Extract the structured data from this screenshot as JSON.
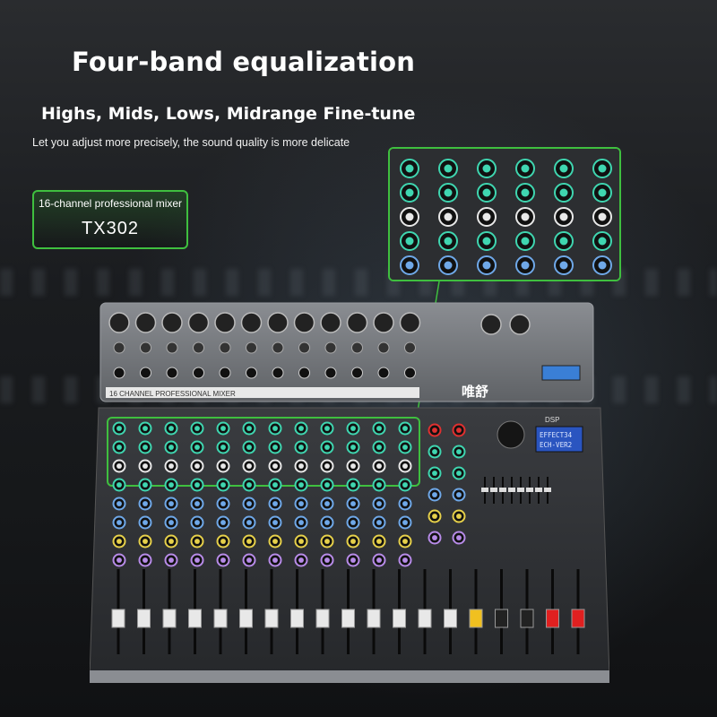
{
  "headline": "Four-band equalization",
  "subhead": "Highs, Mids, Lows, Midrange Fine-tune",
  "tagline": "Let you adjust more precisely, the sound quality is more delicate",
  "model": {
    "label": "16-channel professional mixer",
    "name": "TX302"
  },
  "mixer": {
    "panel_text": "16 CHANNEL PROFESSIONAL MIXER",
    "brand": "唯舒",
    "dsp_badge": "DSP",
    "display_line1": "EFFECT34",
    "display_line2": "ECH-VER2"
  },
  "colors": {
    "highlight": "#3fbf3f",
    "eq_knob": "#3fd6b0",
    "aux_knob": "#6fa8e8",
    "fx_knob": "#e6d04a",
    "pan_knob": "#b78be8",
    "main_fader": "#e02020",
    "effect_fader": "#f0c020"
  }
}
